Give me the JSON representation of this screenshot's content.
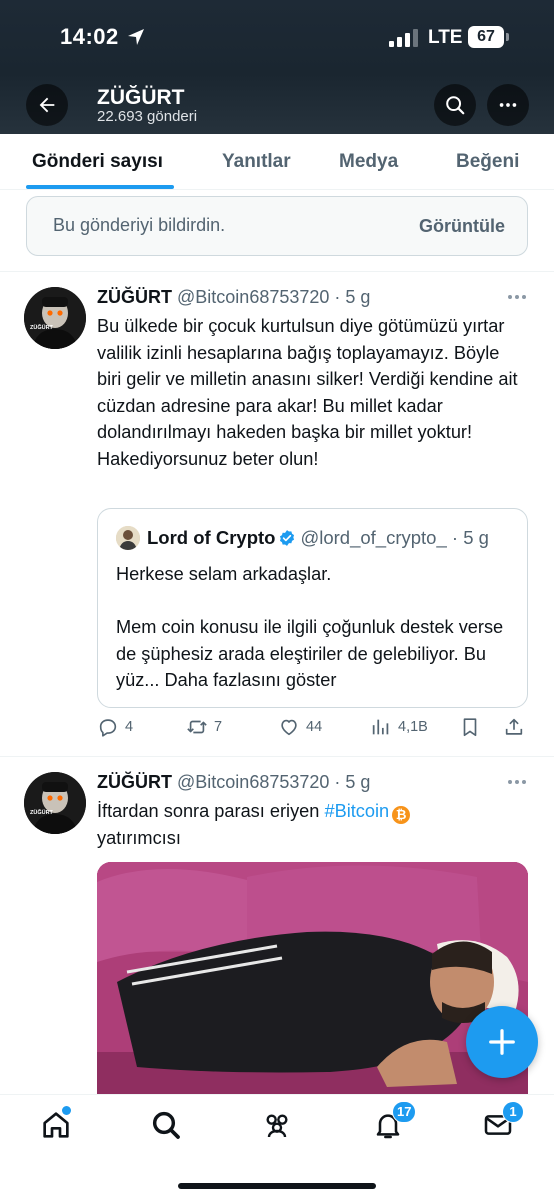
{
  "status_bar": {
    "time": "14:02",
    "network": "LTE",
    "battery": "67"
  },
  "header": {
    "name": "ZÜĞÜRT",
    "post_count": "22.693 gönderi"
  },
  "tabs": [
    {
      "label": "Gönderi sayısı",
      "active": true
    },
    {
      "label": "Yanıtlar"
    },
    {
      "label": "Medya"
    },
    {
      "label": "Beğeni"
    }
  ],
  "notice": {
    "text": "Bu gönderiyi bildirdin.",
    "button": "Görüntüle"
  },
  "tweets": [
    {
      "name": "ZÜĞÜRT",
      "handle": "@Bitcoin68753720",
      "time": "· 5 g",
      "text": "Bu ülkede bir çocuk kurtulsun diye götümüzü yırtar valilik izinli hesaplarına bağış toplayamayız. Böyle biri gelir ve milletin anasını silker! Verdiği kendine ait cüzdan adresine para akar! Bu millet kadar dolandırılmayı hakeden başka bir millet yoktur! Hakediyorsunuz beter olun!",
      "quote": {
        "name": "Lord of Crypto",
        "handle": "@lord_of_crypto_",
        "time": "· 5 g",
        "line1": "Herkese selam arkadaşlar.",
        "line2": "Mem coin konusu ile ilgili çoğunluk destek verse de şüphesiz arada eleştiriler de gelebiliyor. Bu yüz...",
        "show_more": "Daha fazlasını göster"
      },
      "stats": {
        "replies": "4",
        "retweets": "7",
        "likes": "44",
        "views": "4,1B"
      }
    },
    {
      "name": "ZÜĞÜRT",
      "handle": "@Bitcoin68753720",
      "time": "· 5 g",
      "text_before": "İftardan sonra parası eriyen ",
      "hashtag": "#Bitcoin",
      "coin_symbol": "₿",
      "text_after": "yatırımcısı"
    }
  ],
  "bottom_nav": {
    "notifications_badge": "17",
    "messages_badge": "1"
  },
  "colors": {
    "accent": "#1d9bf0",
    "header_bg": "#1e2a36",
    "text": "#0f1419",
    "muted": "#536471"
  }
}
